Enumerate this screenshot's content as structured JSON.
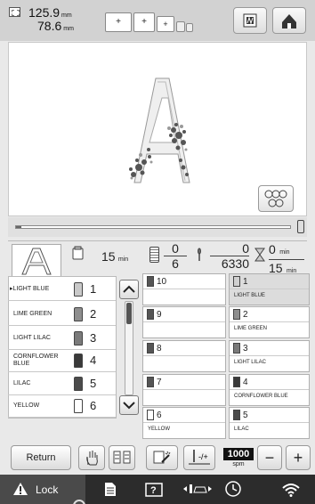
{
  "header": {
    "width_value": "125.9",
    "height_value": "78.6",
    "unit": "mm",
    "sequence_labels": [
      "+",
      "+",
      "+"
    ]
  },
  "progress": {
    "fraction": 0.02
  },
  "status": {
    "time_total": "15",
    "time_unit": "min",
    "color_current": "0",
    "color_total": "6",
    "stitch_current": "0",
    "stitch_total": "6330",
    "remain_current": "0",
    "remain_total": "15",
    "remain_unit": "min"
  },
  "thread_list": [
    {
      "name": "LIGHT BLUE",
      "number": "1",
      "color": "#c9c9c9",
      "selected": true
    },
    {
      "name": "LIME GREEN",
      "number": "2",
      "color": "#8e8e8e"
    },
    {
      "name": "LIGHT LILAC",
      "number": "3",
      "color": "#7a7a7a"
    },
    {
      "name": "CORNFLOWER BLUE",
      "number": "4",
      "color": "#3a3a3a"
    },
    {
      "name": "LILAC",
      "number": "5",
      "color": "#4b4b4b"
    },
    {
      "name": "YELLOW",
      "number": "6",
      "color": "#ffffff"
    }
  ],
  "grid_left": [
    {
      "num": "10",
      "label": "",
      "color": "#555555"
    },
    {
      "num": "9",
      "label": "",
      "color": "#555555"
    },
    {
      "num": "8",
      "label": "",
      "color": "#555555"
    },
    {
      "num": "7",
      "label": "",
      "color": "#555555"
    },
    {
      "num": "6",
      "label": "YELLOW",
      "color": "#ffffff"
    }
  ],
  "grid_right": [
    {
      "num": "1",
      "label": "LIGHT BLUE",
      "color": "#d0d0d0"
    },
    {
      "num": "2",
      "label": "LIME GREEN",
      "color": "#8e8e8e"
    },
    {
      "num": "3",
      "label": "LIGHT LILAC",
      "color": "#7a7a7a"
    },
    {
      "num": "4",
      "label": "CORNFLOWER BLUE",
      "color": "#3a3a3a"
    },
    {
      "num": "5",
      "label": "LILAC",
      "color": "#4b4b4b"
    }
  ],
  "toolbar": {
    "return_label": "Return",
    "speed_value": "1000",
    "speed_unit": "spm",
    "minus": "−",
    "plus": "+"
  },
  "bottom_bar": {
    "lock_label": "Lock"
  }
}
